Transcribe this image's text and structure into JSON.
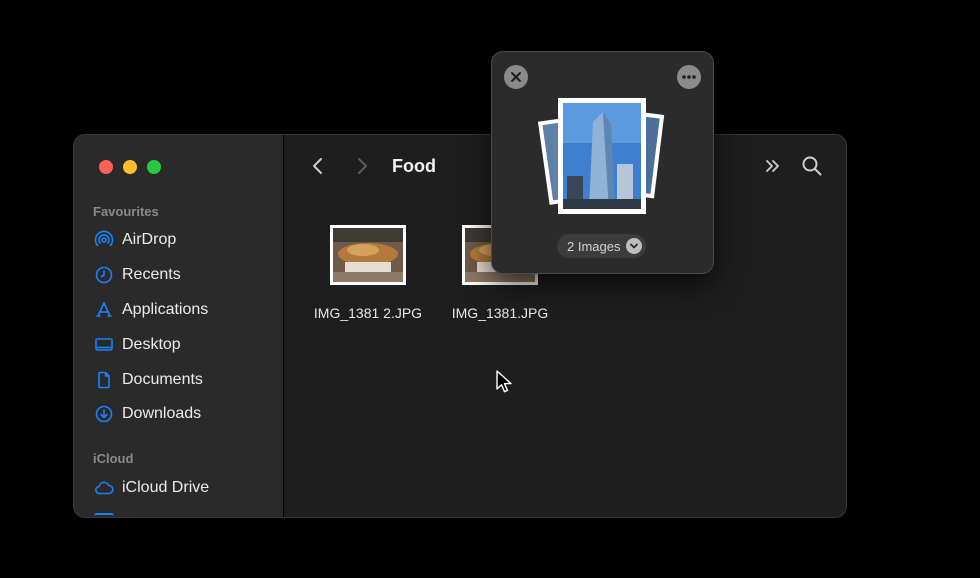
{
  "finder": {
    "title": "Food",
    "sidebar": {
      "sections": [
        {
          "label": "Favourites",
          "items": [
            {
              "label": "AirDrop",
              "icon": "airdrop-icon"
            },
            {
              "label": "Recents",
              "icon": "clock-icon"
            },
            {
              "label": "Applications",
              "icon": "applications-icon"
            },
            {
              "label": "Desktop",
              "icon": "desktop-icon"
            },
            {
              "label": "Documents",
              "icon": "document-icon"
            },
            {
              "label": "Downloads",
              "icon": "download-icon"
            }
          ]
        },
        {
          "label": "iCloud",
          "items": [
            {
              "label": "iCloud Drive",
              "icon": "cloud-icon"
            }
          ]
        }
      ]
    },
    "files": [
      {
        "name": "IMG_1381 2.JPG"
      },
      {
        "name": "IMG_1381.JPG"
      }
    ]
  },
  "drag_popup": {
    "count_label": "2 Images"
  },
  "colors": {
    "accent": "#1a82fb",
    "red": "#ff5f57",
    "yellow": "#febc2e",
    "green": "#28c840"
  }
}
